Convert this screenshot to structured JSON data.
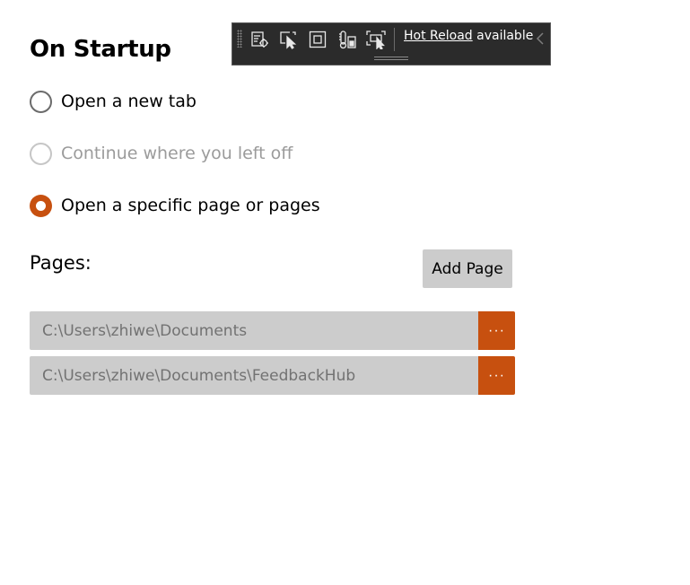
{
  "startup": {
    "title": "On Startup",
    "options": [
      {
        "label": "Open a new tab",
        "checked": false,
        "disabled": false
      },
      {
        "label": "Continue where you left off",
        "checked": false,
        "disabled": true
      },
      {
        "label": "Open a specific page or pages",
        "checked": true,
        "disabled": false
      }
    ]
  },
  "pages": {
    "label": "Pages:",
    "add_button": "Add Page",
    "items": [
      {
        "path": "C:\\Users\\zhiwe\\Documents",
        "browse": "···"
      },
      {
        "path": "C:\\Users\\zhiwe\\Documents\\FeedbackHub",
        "browse": "···"
      }
    ]
  },
  "toolbar": {
    "hot_reload_link": "Hot Reload",
    "hot_reload_text": "available",
    "icons": [
      "live-visual-tree-icon",
      "select-element-icon",
      "display-layout-adorners-icon",
      "track-focus-icon",
      "preview-selection-icon",
      "collapse-chevron-icon"
    ]
  },
  "colors": {
    "accent": "#c7500f",
    "toolbar_bg": "#2b2b2b",
    "field_bg": "#cccccc"
  }
}
